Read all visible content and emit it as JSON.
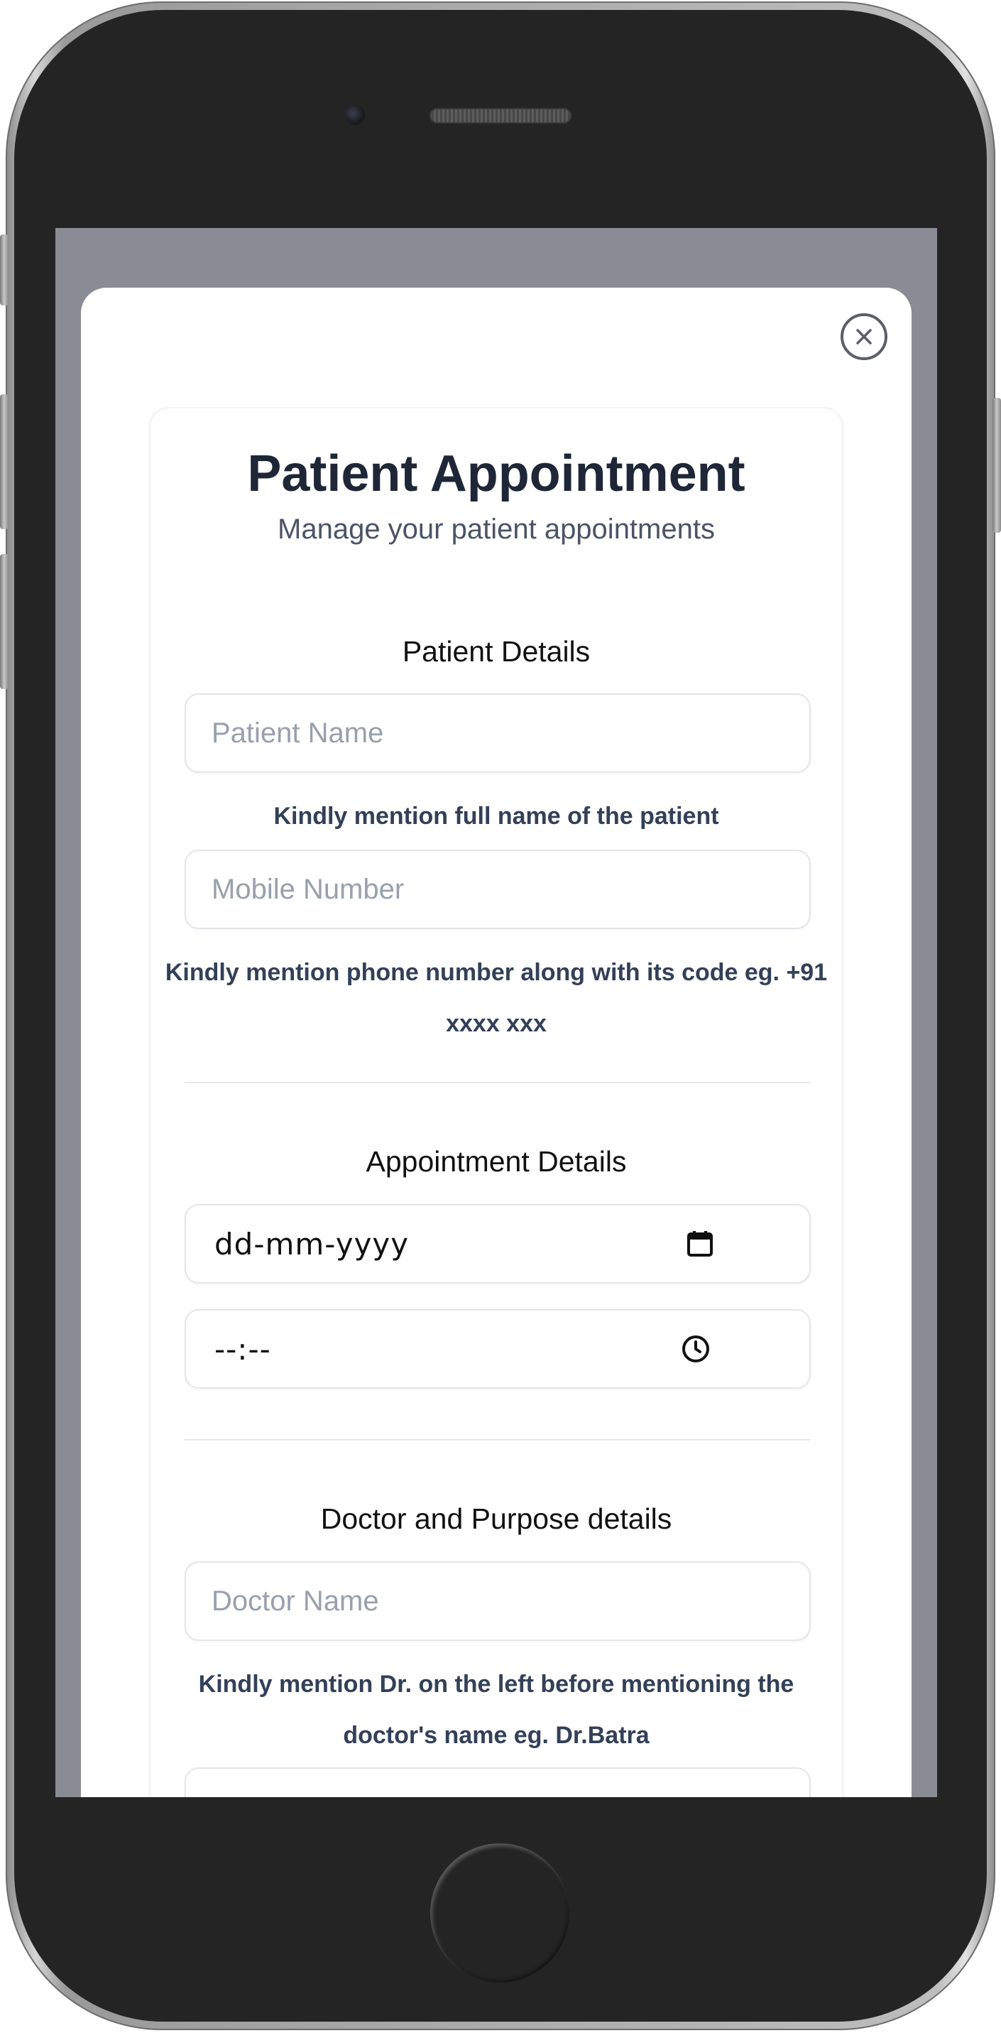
{
  "modal": {
    "title": "Patient Appointment",
    "subtitle": "Manage your patient appointments",
    "close_icon": "close-circle-icon"
  },
  "patient_details": {
    "heading": "Patient Details",
    "name_placeholder": "Patient Name",
    "name_help": "Kindly mention full name of the patient",
    "mobile_placeholder": "Mobile Number",
    "mobile_help": "Kindly mention phone number along with its code eg. +91 xxxx xxx"
  },
  "appointment_details": {
    "heading": "Appointment Details",
    "date_value": "dd-mm-yyyy",
    "date_icon": "calendar-icon",
    "time_value": "--:--",
    "time_icon": "clock-icon"
  },
  "doctor_details": {
    "heading": "Doctor and Purpose details",
    "doctor_placeholder": "Doctor Name",
    "doctor_help": "Kindly mention Dr. on the left before mentioning the doctor's name eg. Dr.Batra"
  },
  "colors": {
    "overlay": "#898c94",
    "title": "#1e2637",
    "help_text": "#334058",
    "placeholder": "#98a0ad"
  }
}
